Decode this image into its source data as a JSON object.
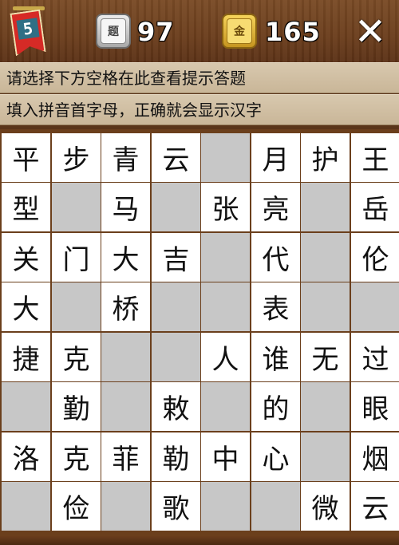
{
  "header": {
    "level": "5",
    "question_tile_glyph": "题",
    "question_count": "97",
    "coin_tile_glyph": "金",
    "coin_count": "165",
    "close_label": "✕"
  },
  "hints": {
    "line1": "请选择下方空格在此查看提示答题",
    "line2": "填入拼音首字母，正确就会显示汉字"
  },
  "grid": [
    [
      "平",
      "步",
      "青",
      "云",
      "",
      "月",
      "护",
      "王"
    ],
    [
      "型",
      "",
      "马",
      "",
      "张",
      "亮",
      "",
      "岳"
    ],
    [
      "关",
      "门",
      "大",
      "吉",
      "",
      "代",
      "",
      "伦"
    ],
    [
      "大",
      "",
      "桥",
      "",
      "",
      "表",
      "",
      ""
    ],
    [
      "捷",
      "克",
      "",
      "",
      "人",
      "谁",
      "无",
      "过"
    ],
    [
      "",
      "勤",
      "",
      "敕",
      "",
      "的",
      "",
      "眼"
    ],
    [
      "洛",
      "克",
      "菲",
      "勒",
      "中",
      "心",
      "",
      "烟"
    ],
    [
      "",
      "俭",
      "",
      "歌",
      "",
      "",
      "微",
      "云"
    ]
  ],
  "grid_white": [
    [
      1,
      1,
      1,
      1,
      0,
      1,
      1,
      1
    ],
    [
      1,
      0,
      1,
      0,
      1,
      1,
      0,
      1
    ],
    [
      1,
      1,
      1,
      1,
      0,
      1,
      0,
      1
    ],
    [
      1,
      0,
      1,
      0,
      0,
      1,
      0,
      0
    ],
    [
      1,
      1,
      0,
      0,
      1,
      1,
      1,
      1
    ],
    [
      0,
      1,
      0,
      1,
      0,
      1,
      0,
      1
    ],
    [
      1,
      1,
      1,
      1,
      1,
      1,
      0,
      1
    ],
    [
      0,
      1,
      0,
      1,
      0,
      0,
      1,
      1
    ]
  ],
  "colors": {
    "wood": "#6a3d1c",
    "cell_white": "#ffffff",
    "cell_blank": "#c7c7c7",
    "flag_red": "#d62a26"
  }
}
